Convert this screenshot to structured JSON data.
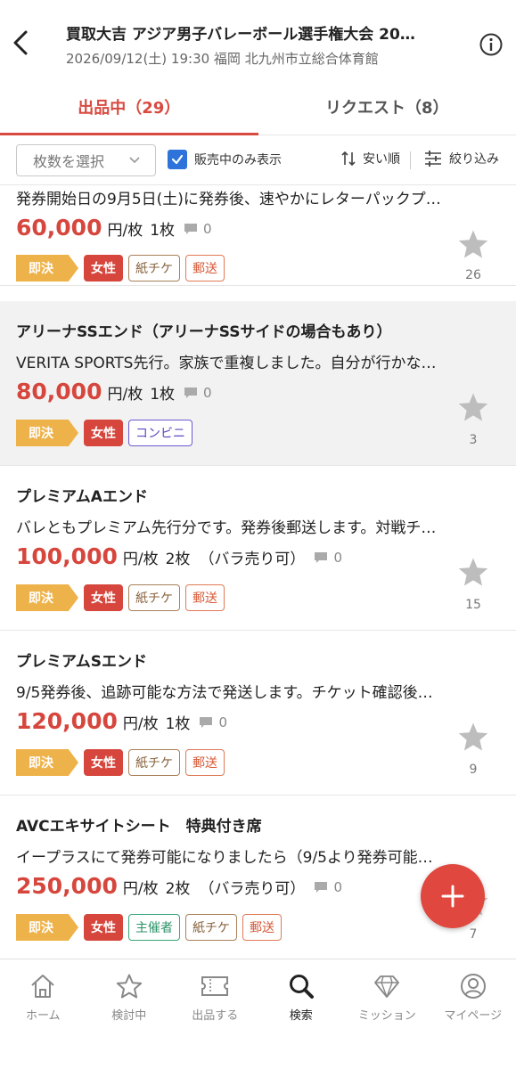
{
  "header": {
    "title": "買取大吉 アジア男子バレーボール選手権大会 20…",
    "subtitle": "2026/09/12(土) 19:30 福岡 北九州市立総合体育館"
  },
  "tabs": [
    {
      "label": "出品中（29）",
      "active": true
    },
    {
      "label": "リクエスト（8）",
      "active": false
    }
  ],
  "filters": {
    "count_select": "枚数を選択",
    "on_sale_only": "販売中のみ表示",
    "sort": "安い順",
    "filter": "絞り込み"
  },
  "listings": [
    {
      "name": "",
      "desc": "発券開始日の9月5日(土)に発券後、速やかにレターパックプ…",
      "price": "60,000",
      "unit": "円/枚",
      "qty": "1枚",
      "note": "",
      "comments": "0",
      "tags": [
        "女性",
        "紙チケ",
        "郵送"
      ],
      "favorites": "26"
    },
    {
      "name": "アリーナSSエンド（アリーナSSサイドの場合もあり）",
      "desc": "VERITA SPORTS先行。家族で重複しました。自分が行かな…",
      "price": "80,000",
      "unit": "円/枚",
      "qty": "1枚",
      "note": "",
      "comments": "0",
      "tags": [
        "女性",
        "コンビニ"
      ],
      "favorites": "3"
    },
    {
      "name": "プレミアムAエンド",
      "desc": "バレともプレミアム先行分です。発券後郵送します。対戦チ…",
      "price": "100,000",
      "unit": "円/枚",
      "qty": "2枚",
      "note": "（バラ売り可）",
      "comments": "0",
      "tags": [
        "女性",
        "紙チケ",
        "郵送"
      ],
      "favorites": "15"
    },
    {
      "name": "プレミアムSエンド",
      "desc": "9/5発券後、追跡可能な方法で発送します。チケット確認後…",
      "price": "120,000",
      "unit": "円/枚",
      "qty": "1枚",
      "note": "",
      "comments": "0",
      "tags": [
        "女性",
        "紙チケ",
        "郵送"
      ],
      "favorites": "9"
    },
    {
      "name": "AVCエキサイトシート　特典付き席",
      "desc": "イープラスにて発券可能になりましたら（9/5より発券可能…",
      "price": "250,000",
      "unit": "円/枚",
      "qty": "2枚",
      "note": "（バラ売り可）",
      "comments": "0",
      "tags": [
        "女性",
        "主催者",
        "紙チケ",
        "郵送"
      ],
      "favorites": "7"
    }
  ],
  "sokketsu_label": "即決",
  "bottom_nav": [
    {
      "label": "ホーム",
      "icon": "home-icon"
    },
    {
      "label": "検討中",
      "icon": "star-icon"
    },
    {
      "label": "出品する",
      "icon": "ticket-icon"
    },
    {
      "label": "検索",
      "icon": "search-icon",
      "active": true
    },
    {
      "label": "ミッション",
      "icon": "diamond-icon"
    },
    {
      "label": "マイページ",
      "icon": "user-icon"
    }
  ],
  "colors": {
    "accent": "#d84a40",
    "price": "#d6463d",
    "checkbox": "#2d73d9",
    "sokketsu": "#eeb24a"
  }
}
